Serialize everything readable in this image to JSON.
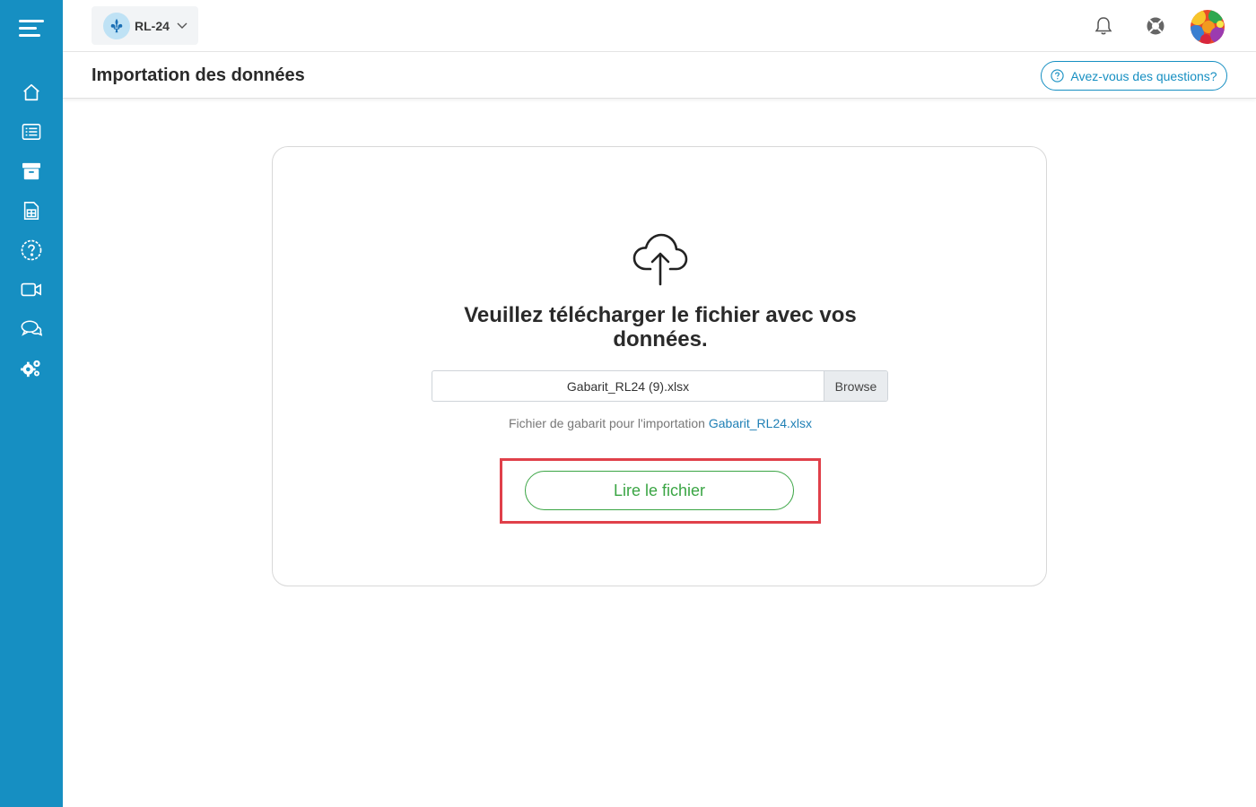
{
  "sidebar": {
    "items": [
      {
        "name": "home-icon"
      },
      {
        "name": "list-icon"
      },
      {
        "name": "archive-icon"
      },
      {
        "name": "spreadsheet-icon"
      },
      {
        "name": "help-circle-icon"
      },
      {
        "name": "video-icon"
      },
      {
        "name": "chat-icon"
      },
      {
        "name": "settings-gears-icon"
      }
    ]
  },
  "header": {
    "project_label": "RL-24"
  },
  "titlebar": {
    "title": "Importation des données",
    "help_label": "Avez-vous des questions?"
  },
  "upload": {
    "heading": "Veuillez télécharger le fichier avec vos données.",
    "file_name": "Gabarit_RL24 (9).xlsx",
    "browse_label": "Browse",
    "template_text": "Fichier de gabarit pour l'importation",
    "template_link": "Gabarit_RL24.xlsx",
    "read_button": "Lire le fichier"
  },
  "colors": {
    "sidebar": "#168fc2",
    "accent_blue": "#168fc2",
    "button_green": "#3aa544",
    "highlight_red": "#e0404a"
  }
}
